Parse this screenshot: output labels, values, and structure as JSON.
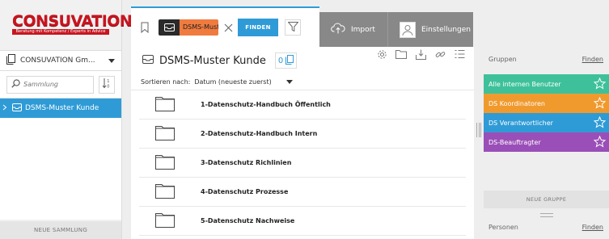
{
  "logo": {
    "brand": "CONSUVATION",
    "tagline": "Beratung mit Kompetenz / Experts in Advice"
  },
  "sidebar": {
    "collection_name": "CONSUVATION Gm...",
    "search_placeholder": "Sammlung",
    "tree_items": [
      {
        "label": "DSMS-Muster Kunde",
        "selected": true
      }
    ],
    "new_collection_label": "NEUE SAMMLUNG"
  },
  "toolbar": {
    "chip_label": "DSMS-Must",
    "find_label": "FINDEN",
    "import_label": "Import",
    "settings_label": "Einstellungen"
  },
  "main": {
    "title": "DSMS-Muster Kunde",
    "count": "0",
    "sort_label": "Sortieren nach:",
    "sort_value": "Datum (neueste zuerst)",
    "folders": [
      "1-Datenschutz-Handbuch Öffentlich",
      "2-Datenschutz-Handbuch Intern",
      "3-Datenschutz Richlinien",
      "4-Datenschutz Prozesse",
      "5-Datenschutz Nachweise"
    ]
  },
  "right": {
    "groups_label": "Gruppen",
    "groups_find": "Finden",
    "groups": [
      {
        "name": "Alle internen Benutzer",
        "color": "#3ec19a"
      },
      {
        "name": "DS Koordinatoren",
        "color": "#f09a2e"
      },
      {
        "name": "DS Verantwortlicher",
        "color": "#2f9bd6"
      },
      {
        "name": "DS-Beauftragter",
        "color": "#9a4fb8"
      }
    ],
    "new_group_label": "NEUE GRUPPE",
    "persons_label": "Personen",
    "persons_find": "Finden"
  },
  "colors": {
    "accent": "#2f9bd6",
    "chip": "#f07b3f",
    "brand": "#c8151f",
    "toolbar_gray": "#888888"
  }
}
